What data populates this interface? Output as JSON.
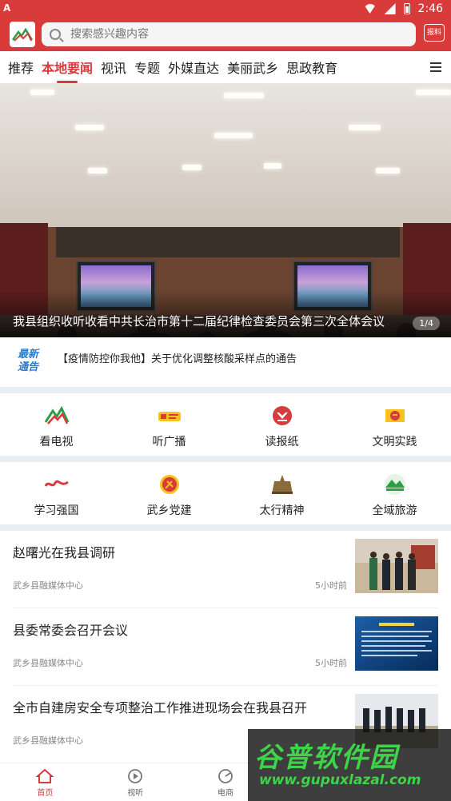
{
  "status_bar": {
    "left_label": "A",
    "time": "2:46"
  },
  "header": {
    "search_placeholder": "搜索感兴趣内容",
    "report_label": "报料"
  },
  "tabs": [
    {
      "label": "推荐",
      "active": false
    },
    {
      "label": "本地要闻",
      "active": true
    },
    {
      "label": "视讯",
      "active": false
    },
    {
      "label": "专题",
      "active": false
    },
    {
      "label": "外媒直达",
      "active": false
    },
    {
      "label": "美丽武乡",
      "active": false
    },
    {
      "label": "思政教育",
      "active": false
    }
  ],
  "banner": {
    "caption": "我县组织收听收看中共长治市第十二届纪律检查委员会第三次全体会议",
    "index": "1/4"
  },
  "notice": {
    "badge_line1": "最新",
    "badge_line2": "通告",
    "text": "【疫情防控你我他】关于优化调整核酸采样点的通告"
  },
  "shortcuts_row1": [
    {
      "label": "看电视",
      "icon": "tv-mountain-icon"
    },
    {
      "label": "听广播",
      "icon": "radio-icon"
    },
    {
      "label": "读报纸",
      "icon": "newspaper-icon"
    },
    {
      "label": "文明实践",
      "icon": "civilization-practice-icon"
    }
  ],
  "shortcuts_row2": [
    {
      "label": "学习强国",
      "icon": "xuexi-qiangguo-icon"
    },
    {
      "label": "武乡党建",
      "icon": "party-building-icon"
    },
    {
      "label": "太行精神",
      "icon": "taihang-monument-icon"
    },
    {
      "label": "全域旅游",
      "icon": "tourism-icon"
    }
  ],
  "news": [
    {
      "title": "赵曙光在我县调研",
      "source": "武乡县融媒体中心",
      "time": "5小时前"
    },
    {
      "title": "县委常委会召开会议",
      "source": "武乡县融媒体中心",
      "time": "5小时前"
    },
    {
      "title": "全市自建房安全专项整治工作推进现场会在我县召开",
      "source": "武乡县融媒体中心",
      "time": ""
    }
  ],
  "bottom_nav": [
    {
      "label": "首页",
      "active": true
    },
    {
      "label": "视听",
      "active": false
    },
    {
      "label": "电商",
      "active": false
    },
    {
      "label": "",
      "active": false
    },
    {
      "label": "",
      "active": false
    }
  ],
  "watermark": {
    "title": "谷普软件园",
    "url": "www.gupuxlazal.com"
  },
  "colors": {
    "brand_red": "#d93a3a",
    "notice_blue": "#2a7cd1",
    "page_gap": "#e9eef5"
  }
}
